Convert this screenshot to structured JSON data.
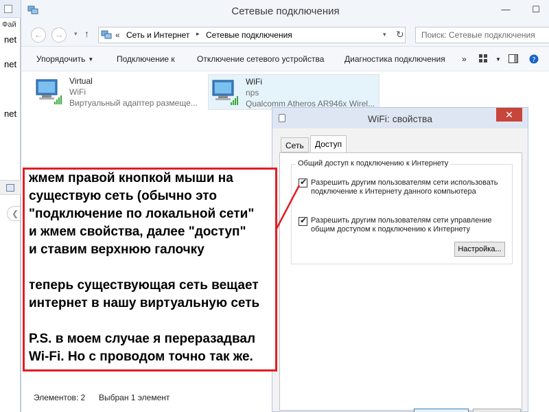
{
  "background_window": {
    "menu_label": "Фай",
    "lines": [
      "net",
      "net",
      "net"
    ],
    "back_glyph": "❮"
  },
  "window": {
    "title": "Сетевые подключения",
    "buttons": {
      "minimize": "—",
      "maximize": "☐"
    }
  },
  "address_bar": {
    "back": "←",
    "forward": "→",
    "history": "▾",
    "up": "↑",
    "arrows": "«",
    "crumbs": [
      "Сеть и Интернет",
      "Сетевые подключения"
    ],
    "crumb_separator": "▸",
    "dropdown": "▾",
    "refresh": "↻",
    "search_placeholder": "Поиск: Сетевые подключения"
  },
  "command_bar": {
    "items": [
      "Упорядочить",
      "Подключение к",
      "Отключение сетевого устройства",
      "Диагностика подключения"
    ],
    "organize_caret": "▼",
    "more": "»"
  },
  "items": [
    {
      "name": "Virtual",
      "type": "WiFi",
      "description": "Виртуальный адаптер размеще..."
    },
    {
      "name": "WiFi",
      "type": "nps",
      "description": "Qualcomm Atheros AR946x Wirel..."
    }
  ],
  "status_bar": {
    "count": "Элементов: 2",
    "selected": "Выбран 1 элемент"
  },
  "dialog": {
    "title": "WiFi: свойства",
    "close": "✕",
    "tabs": [
      "Сеть",
      "Доступ"
    ],
    "active_tab": "Доступ",
    "group_title": "Общий доступ к подключению к Интернету",
    "checkbox1": {
      "checked": true,
      "line1": "Разрешить другим пользователям сети использовать",
      "line2": "подключение к Интернету данного компьютера"
    },
    "checkbox2": {
      "checked": true,
      "line1": "Разрешить другим пользователям сети управление",
      "line2": "общим доступом к подключению к Интернету"
    },
    "check_glyph": "✔",
    "settings_button": "Настройка..."
  },
  "annotation": {
    "border_color": "#e21d24",
    "lines": [
      "жмем правой кнопкой мыши на",
      "существую сеть (обычно это",
      "\"подключение по локальной сети\"",
      "и жмем свойства, далее \"доступ\"",
      "и ставим верхнюю галочку",
      "",
      "теперь существующая сеть вещает",
      "интернет в нашу виртуальную сеть",
      "",
      "P.S. в моем случае я переразадвал",
      "Wi-Fi. Но с проводом точно так же."
    ]
  }
}
